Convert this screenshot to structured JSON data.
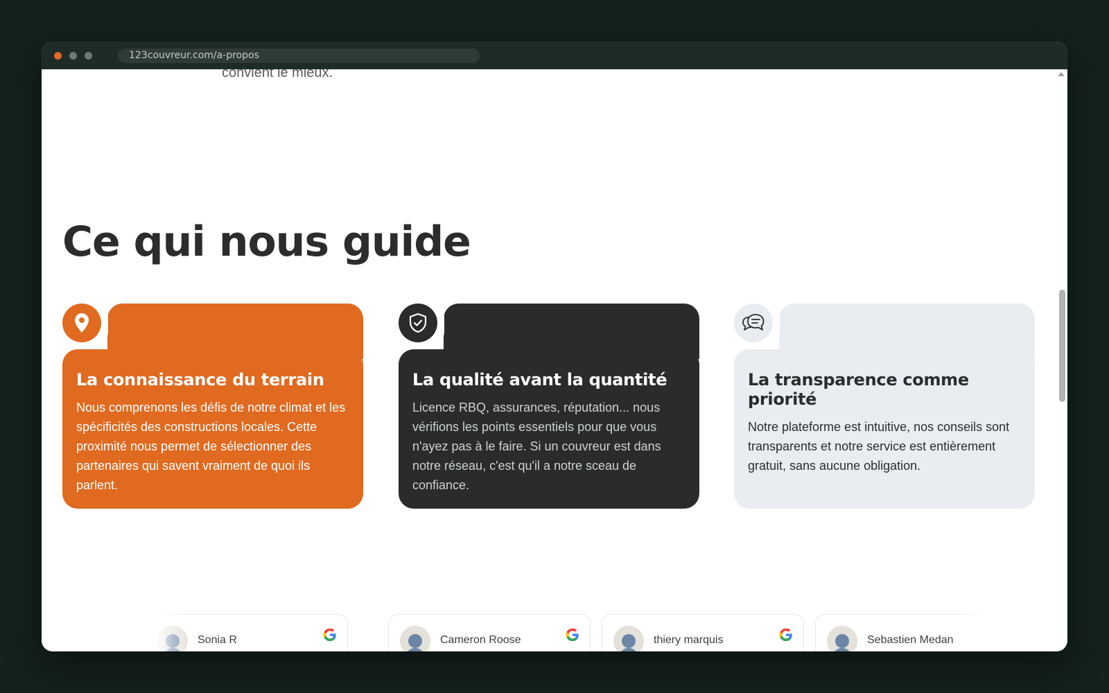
{
  "browser": {
    "url": "123couvreur.com/a-propos"
  },
  "page": {
    "previous_text": "convient le mieux.",
    "section_title": "Ce qui nous guide",
    "cards": [
      {
        "icon": "map-pin-icon",
        "title": "La connaissance du terrain",
        "text": "Nous comprenons les défis de notre climat et les spécificités des constructions locales. Cette proximité nous permet de sélectionner des partenaires qui savent vraiment de quoi ils parlent."
      },
      {
        "icon": "shield-check-icon",
        "title": "La qualité avant la quantité",
        "text": "Licence RBQ, assurances, réputation... nous vérifions les points essentiels pour que vous n'ayez pas à le faire. Si un couvreur est dans notre réseau, c'est qu'il a notre sceau de confiance."
      },
      {
        "icon": "chat-bubbles-icon",
        "title": "La transparence comme priorité",
        "text": "Notre plateforme est intuitive, nos conseils sont transparents et notre service est entièrement gratuit, sans aucune obligation."
      }
    ],
    "reviews": [
      {
        "name": "Sonia R"
      },
      {
        "name": "Cameron Roose"
      },
      {
        "name": "thiery marquis"
      },
      {
        "name": "Sebastien Medan"
      }
    ]
  },
  "colors": {
    "accent_orange": "#df6a20",
    "dark_card": "#2a2c2c",
    "light_card": "#e9ecf1",
    "page_background": "#14211d"
  }
}
